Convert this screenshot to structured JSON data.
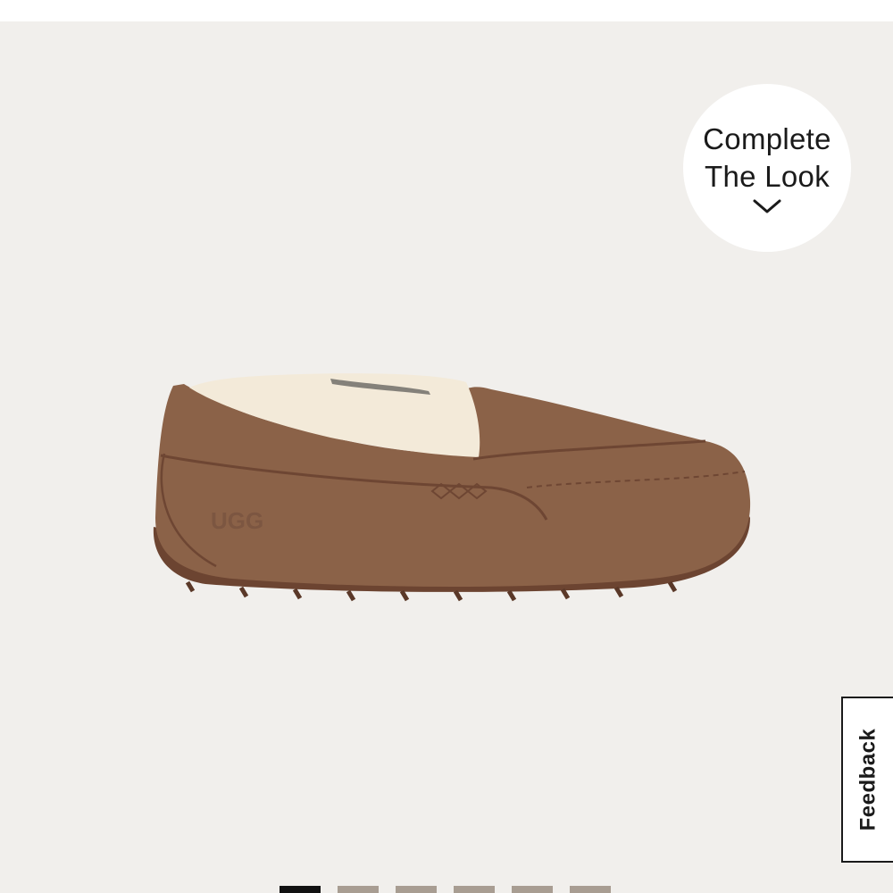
{
  "complete_look": {
    "line1": "Complete",
    "line2": "The Look",
    "icon": "chevron-down-icon"
  },
  "feedback": {
    "label": "Feedback"
  },
  "product": {
    "logo_text": "UGG"
  },
  "pager": {
    "count": 6,
    "active_index": 0
  },
  "colors": {
    "stage_bg": "#f1efec",
    "suede": "#8b6248",
    "fleece": "#f3ead9",
    "pager_active": "#111111",
    "pager_inactive": "#a89d92"
  }
}
